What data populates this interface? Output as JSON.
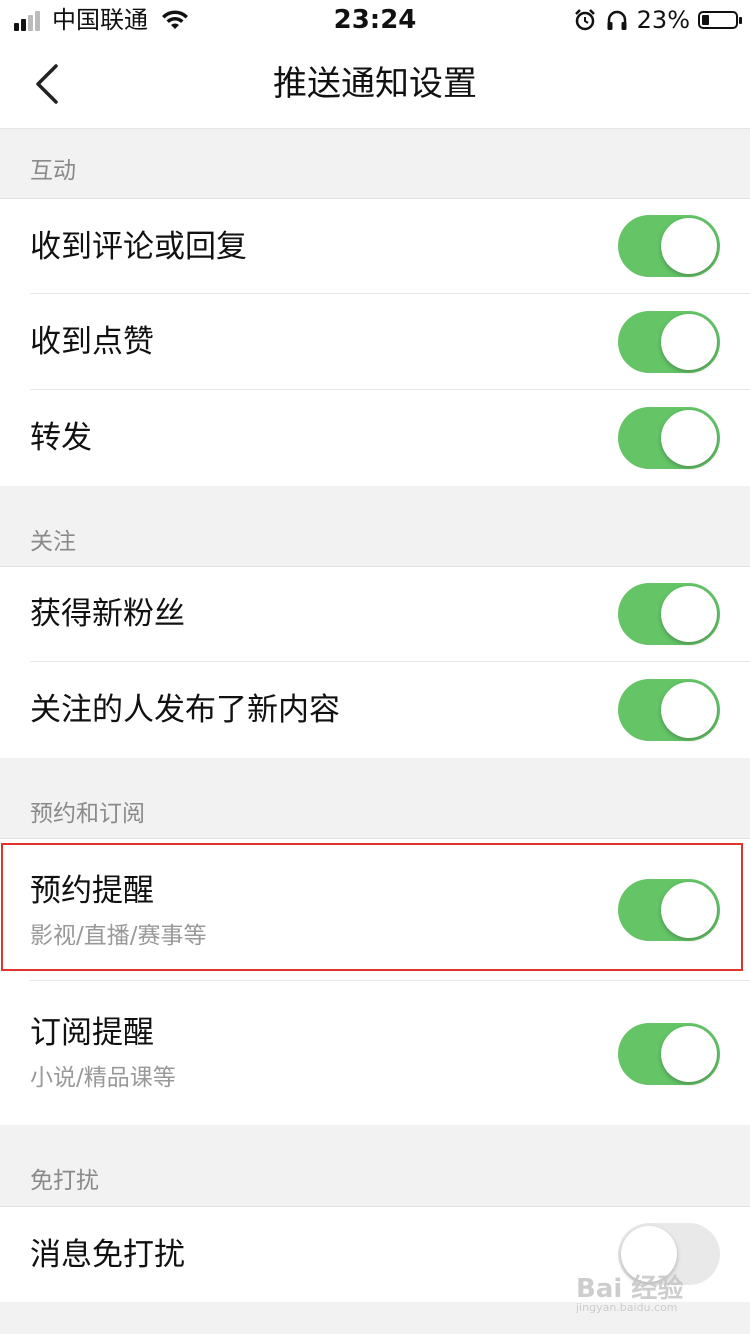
{
  "status_bar": {
    "carrier": "中国联通",
    "time": "23:24",
    "battery_percent": "23%",
    "icons": [
      "signal-icon",
      "wifi-icon",
      "alarm-icon",
      "headphones-icon",
      "battery-icon"
    ]
  },
  "nav": {
    "title": "推送通知设置",
    "back_icon": "chevron-left-icon"
  },
  "sections": [
    {
      "header": "互动",
      "items": [
        {
          "label": "收到评论或回复",
          "enabled": true
        },
        {
          "label": "收到点赞",
          "enabled": true
        },
        {
          "label": "转发",
          "enabled": true
        }
      ]
    },
    {
      "header": "关注",
      "items": [
        {
          "label": "获得新粉丝",
          "enabled": true
        },
        {
          "label": "关注的人发布了新内容",
          "enabled": true
        }
      ]
    },
    {
      "header": "预约和订阅",
      "items": [
        {
          "label": "预约提醒",
          "sublabel": "影视/直播/赛事等",
          "enabled": true,
          "highlighted": true
        },
        {
          "label": "订阅提醒",
          "sublabel": "小说/精品课等",
          "enabled": true
        }
      ]
    },
    {
      "header": "免打扰",
      "items": [
        {
          "label": "消息免打扰",
          "enabled": false
        }
      ]
    }
  ],
  "colors": {
    "toggle_on": "#64c466",
    "toggle_off": "#e9e9ea",
    "highlight_border": "#e0352b",
    "background": "#f2f2f2"
  },
  "watermark": {
    "text": "Bai 经验",
    "sub": "jingyan.baidu.com"
  }
}
